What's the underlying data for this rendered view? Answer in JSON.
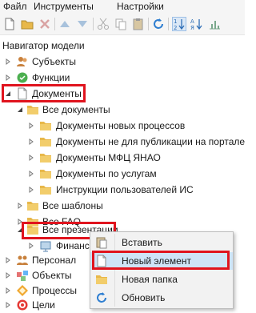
{
  "menubar": {
    "items": [
      "Файл",
      "Инструменты",
      "Настройки"
    ]
  },
  "panel": {
    "title": "Навигатор модели"
  },
  "tree": {
    "subjects": "Субъекты",
    "functions": "Функции",
    "documents": "Документы",
    "all_documents": "Все документы",
    "doc_new_processes": "Документы новых процессов",
    "doc_not_published": "Документы не для публикации на портале",
    "doc_mfc": "Документы МФЦ ЯНАО",
    "doc_services": "Документы по услугам",
    "user_instructions": "Инструкции пользователей ИС",
    "all_templates": "Все шаблоны",
    "all_faq": "Все FAQ",
    "all_presentations": "Все презентации",
    "finance": "Финансо",
    "personnel": "Персонал",
    "objects": "Объекты",
    "processes": "Процессы",
    "goals": "Цели"
  },
  "context_menu": {
    "insert": "Вставить",
    "new_element": "Новый элемент",
    "new_folder": "Новая папка",
    "refresh": "Обновить"
  },
  "colors": {
    "highlight": "#e0141e",
    "folder": "#e8b84a",
    "menu_hover": "#cfe4f7"
  }
}
